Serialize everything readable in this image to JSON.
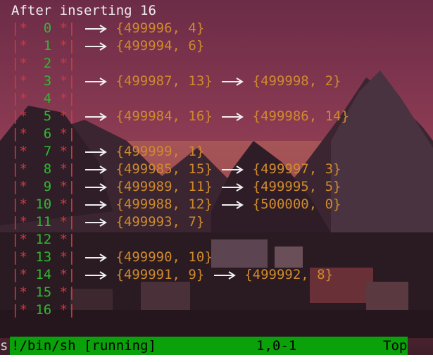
{
  "terminal": {
    "heading": "After inserting 16",
    "rows": [
      {
        "index": "0",
        "pairs": [
          "{499996, 4}"
        ]
      },
      {
        "index": "1",
        "pairs": [
          "{499994, 6}"
        ]
      },
      {
        "index": "2",
        "pairs": []
      },
      {
        "index": "3",
        "pairs": [
          "{499987, 13}",
          "{499998, 2}"
        ]
      },
      {
        "index": "4",
        "pairs": []
      },
      {
        "index": "5",
        "pairs": [
          "{499984, 16}",
          "{499986, 14}"
        ]
      },
      {
        "index": "6",
        "pairs": []
      },
      {
        "index": "7",
        "pairs": [
          "{499999, 1}"
        ]
      },
      {
        "index": "8",
        "pairs": [
          "{499985, 15}",
          "{499997, 3}"
        ]
      },
      {
        "index": "9",
        "pairs": [
          "{499989, 11}",
          "{499995, 5}"
        ]
      },
      {
        "index": "10",
        "pairs": [
          "{499988, 12}",
          "{500000, 0}"
        ]
      },
      {
        "index": "11",
        "pairs": [
          "{499993, 7}"
        ]
      },
      {
        "index": "12",
        "pairs": []
      },
      {
        "index": "13",
        "pairs": [
          "{499990, 10}"
        ]
      },
      {
        "index": "14",
        "pairs": [
          "{499991, 9}",
          "{499992, 8}"
        ]
      },
      {
        "index": "15",
        "pairs": []
      },
      {
        "index": "16",
        "pairs": []
      }
    ]
  },
  "statusbar": {
    "command": "!/bin/sh [running]",
    "position": "1,0-1",
    "scroll": "Top"
  },
  "left_edge_char": "s",
  "colors": {
    "bar": "#d2373f",
    "index": "#2fba2f",
    "pair": "#cf8a2e",
    "arrow": "#f0f0f0",
    "statusbar": "#0aa10a"
  },
  "icons": {
    "arrow": "right-arrow-icon"
  }
}
